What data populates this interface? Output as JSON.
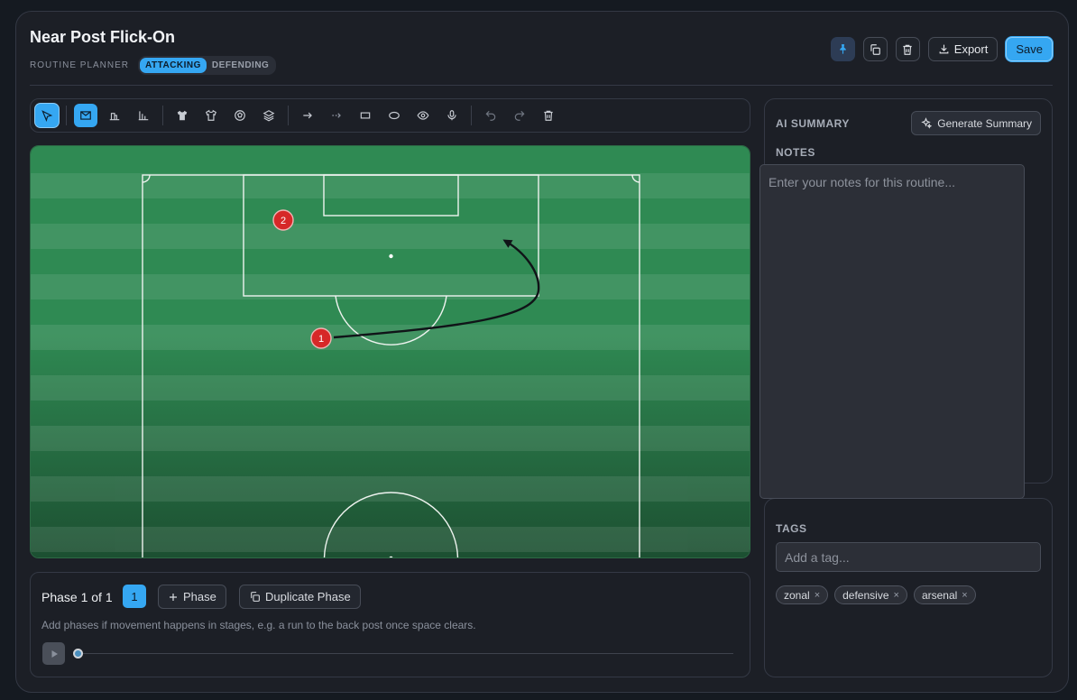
{
  "header": {
    "title": "Near Post Flick-On",
    "subtitle": "ROUTINE PLANNER",
    "modes": [
      "ATTACKING",
      "DEFENDING"
    ],
    "active_mode": "ATTACKING",
    "export_label": "Export",
    "save_label": "Save"
  },
  "pitch": {
    "players": [
      {
        "number": "1",
        "color": "#d62828"
      },
      {
        "number": "2",
        "color": "#d62828"
      }
    ]
  },
  "phase": {
    "title": "Phase 1 of 1",
    "current": "1",
    "add_label": "Phase",
    "duplicate_label": "Duplicate Phase",
    "hint": "Add phases if movement happens in stages, e.g. a run to the back post once space clears.",
    "progress": 0
  },
  "summary": {
    "heading": "AI SUMMARY",
    "generate_label": "Generate Summary",
    "notes_label": "NOTES",
    "notes_placeholder": "Enter your notes for this routine..."
  },
  "tags": {
    "heading": "TAGS",
    "placeholder": "Add a tag...",
    "items": [
      "zonal",
      "defensive",
      "arsenal"
    ]
  },
  "colors": {
    "accent": "#35a7f2",
    "pitch_light": "#34915a",
    "pitch_dark": "#1f5a37"
  }
}
